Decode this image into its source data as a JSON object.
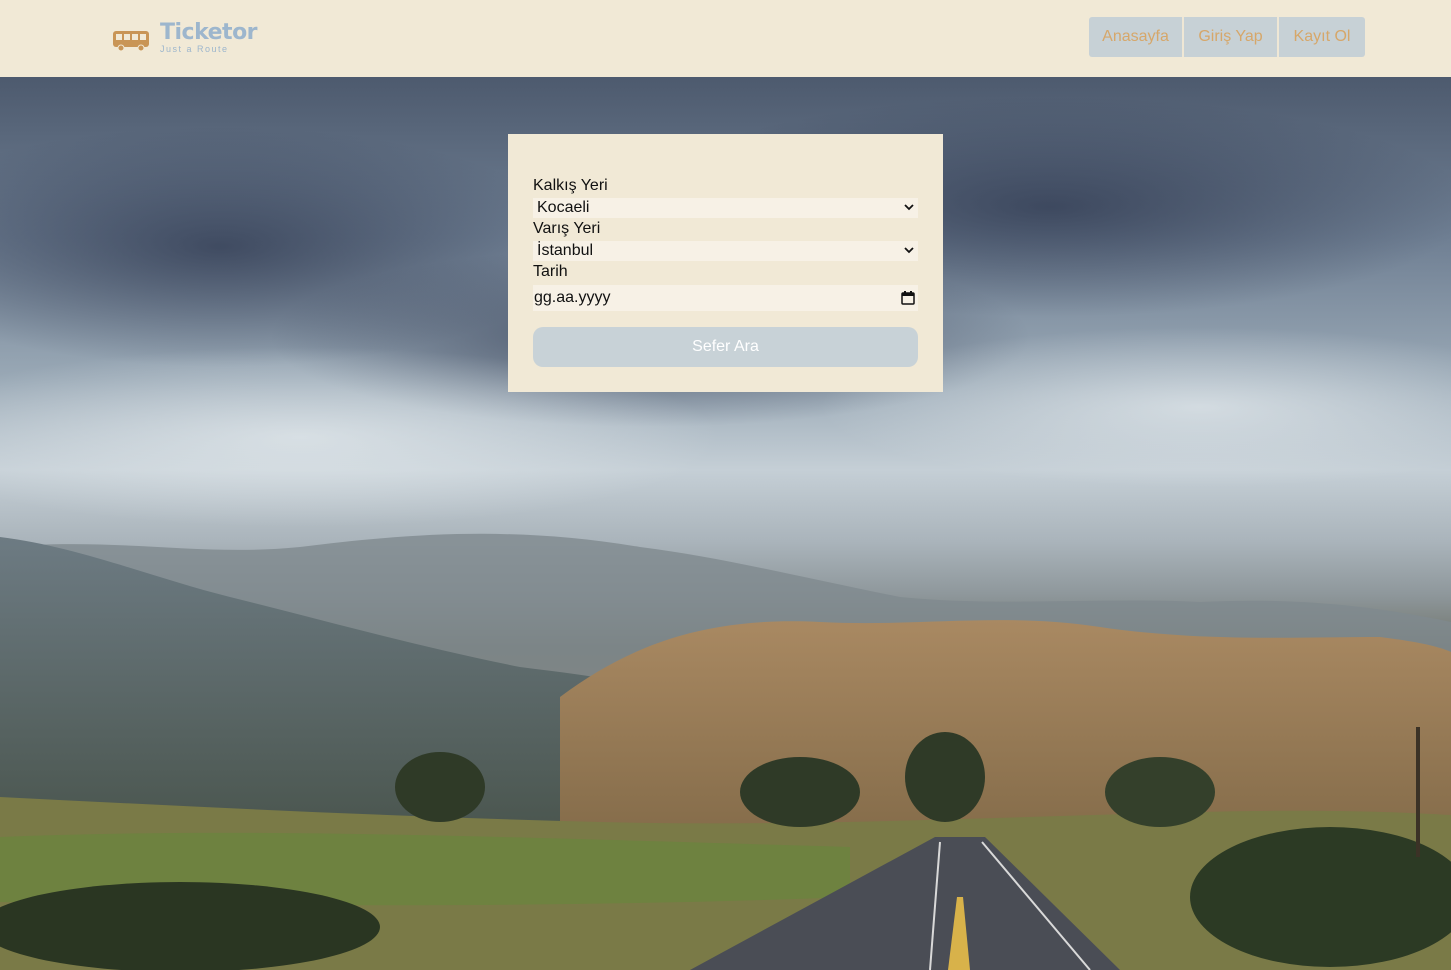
{
  "header": {
    "brand_name": "Ticketor",
    "brand_tagline": "Just a Route",
    "nav": [
      "Anasayfa",
      "Giriş Yap",
      "Kayıt Ol"
    ]
  },
  "search": {
    "departure_label": "Kalkış Yeri",
    "departure_value": "Kocaeli",
    "arrival_label": "Varış Yeri",
    "arrival_value": "İstanbul",
    "date_label": "Tarih",
    "date_placeholder": "gg.aa.yyyy",
    "submit_label": "Sefer Ara"
  },
  "colors": {
    "header_bg": "#f1e9d6",
    "nav_bg": "#c7d1d6",
    "nav_text": "#d6a76a",
    "brand": "#9db6cd",
    "button_bg": "#c8d2d7"
  },
  "icons": {
    "logo": "bus-icon",
    "select": "chevron-down-icon",
    "date": "calendar-icon"
  }
}
